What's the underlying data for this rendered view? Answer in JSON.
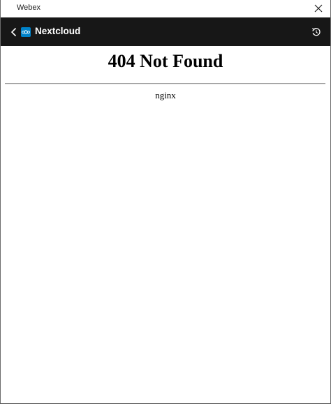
{
  "window": {
    "title": "Webex"
  },
  "appbar": {
    "app_name": "Nextcloud"
  },
  "page": {
    "heading": "404 Not Found",
    "server": "nginx"
  },
  "icons": {
    "close": "close-icon",
    "back": "chevron-left-icon",
    "logo": "nextcloud-logo-icon",
    "refresh": "refresh-icon"
  },
  "colors": {
    "appbar_bg": "#171717",
    "logo_bg": "#0082c9"
  }
}
